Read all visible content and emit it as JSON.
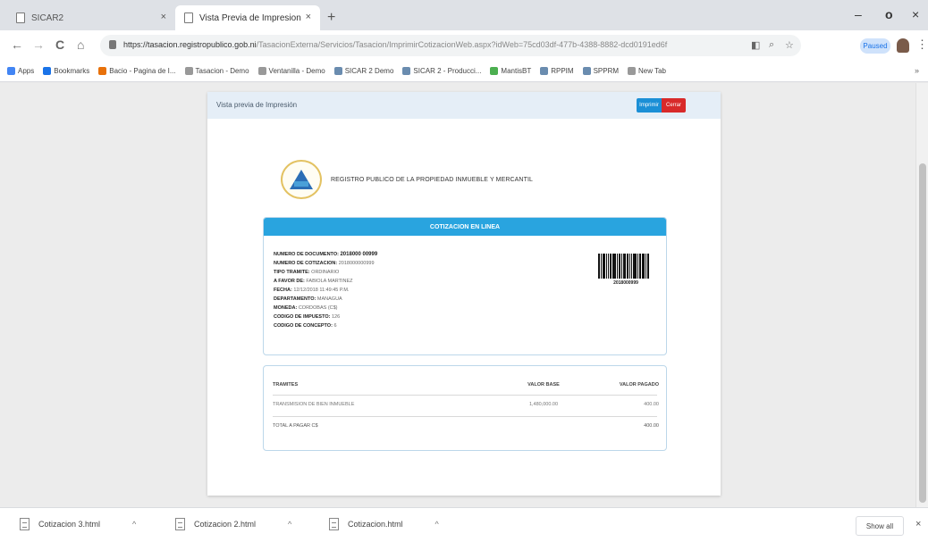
{
  "browser": {
    "tabs": [
      {
        "title": "SICAR2"
      },
      {
        "title": "Vista Previa de Impresion"
      }
    ],
    "new_tab": "+",
    "window_controls": {
      "minimize": "–",
      "maximize": "o",
      "close": "×"
    },
    "nav": {
      "back": "←",
      "forward": "→",
      "reload": "C",
      "home": "⌂"
    },
    "url_host": "https://tasacion.registropublico.gob.ni",
    "url_path": "/TasacionExterna/Servicios/Tasacion/ImprimirCotizacionWeb.aspx?idWeb=75cd03df-477b-4388-8882-dcd0191ed6f",
    "paused_label": "Paused",
    "menu": "⋮"
  },
  "bookmarks": [
    {
      "label": "Apps",
      "icon": "apps-grid-icon",
      "color": "#4285f4"
    },
    {
      "label": "Bookmarks",
      "icon": "star-icon",
      "color": "#1a73e8"
    },
    {
      "label": "Bacio - Pagina de I...",
      "icon": "site-icon",
      "color": "#e8710a"
    },
    {
      "label": "Tasacion - Demo",
      "icon": "page-icon",
      "color": "#999999"
    },
    {
      "label": "Ventanilla - Demo",
      "icon": "page-icon",
      "color": "#999999"
    },
    {
      "label": "SICAR 2 Demo",
      "icon": "app-icon",
      "color": "#6a8caf"
    },
    {
      "label": "SICAR 2 - Producci...",
      "icon": "app-icon",
      "color": "#6a8caf"
    },
    {
      "label": "MantisBT",
      "icon": "mantis-icon",
      "color": "#4caf50"
    },
    {
      "label": "RPPIM",
      "icon": "app-icon",
      "color": "#6a8caf"
    },
    {
      "label": "SPPRM",
      "icon": "app-icon",
      "color": "#6a8caf"
    },
    {
      "label": "New Tab",
      "icon": "page-icon",
      "color": "#999999"
    }
  ],
  "page": {
    "header_title": "Vista previa de Impresión",
    "print_label": "Imprimir",
    "close_label": "Cerrar",
    "agency": "REGISTRO PUBLICO DE LA PROPIEDAD INMUEBLE Y MERCANTIL",
    "panel_title": "COTIZACION EN LINEA",
    "fields": [
      {
        "key": "NUMERO DE DOCUMENTO:",
        "value": "2018000 00999",
        "strong": true
      },
      {
        "key": "NUMERO DE COTIZACION:",
        "value": "2018000000999",
        "strong": false
      },
      {
        "key": "TIPO TRAMITE:",
        "value": "ORDINARIO",
        "strong": false
      },
      {
        "key": "A FAVOR DE:",
        "value": "FABIOLA MARTINEZ",
        "strong": false
      },
      {
        "key": "FECHA:",
        "value": "12/12/2018 11:49:45 P.M.",
        "strong": false
      },
      {
        "key": "DEPARTAMENTO:",
        "value": "MANAGUA",
        "strong": false
      },
      {
        "key": "MONEDA:",
        "value": "CORDOBAS (C$)",
        "strong": false
      },
      {
        "key": "CODIGO DE IMPUESTO:",
        "value": "126",
        "strong": false
      },
      {
        "key": "CODIGO DE CONCEPTO:",
        "value": "6",
        "strong": false
      }
    ],
    "barcode_number": "2018000999",
    "table": {
      "headers": [
        "TRAMITES",
        "VALOR BASE",
        "VALOR PAGADO"
      ],
      "rows": [
        [
          "TRANSMISION DE BIEN INMUEBLE",
          "1,480,000.00",
          "400.00"
        ]
      ],
      "total_label": "TOTAL A PAGAR C$",
      "total_value": "400.00"
    }
  },
  "downloads": {
    "items": [
      {
        "name": "Cotizacion 3.html"
      },
      {
        "name": "Cotizacion 2.html"
      },
      {
        "name": "Cotizacion.html"
      }
    ],
    "show_all": "Show all",
    "close": "×"
  }
}
